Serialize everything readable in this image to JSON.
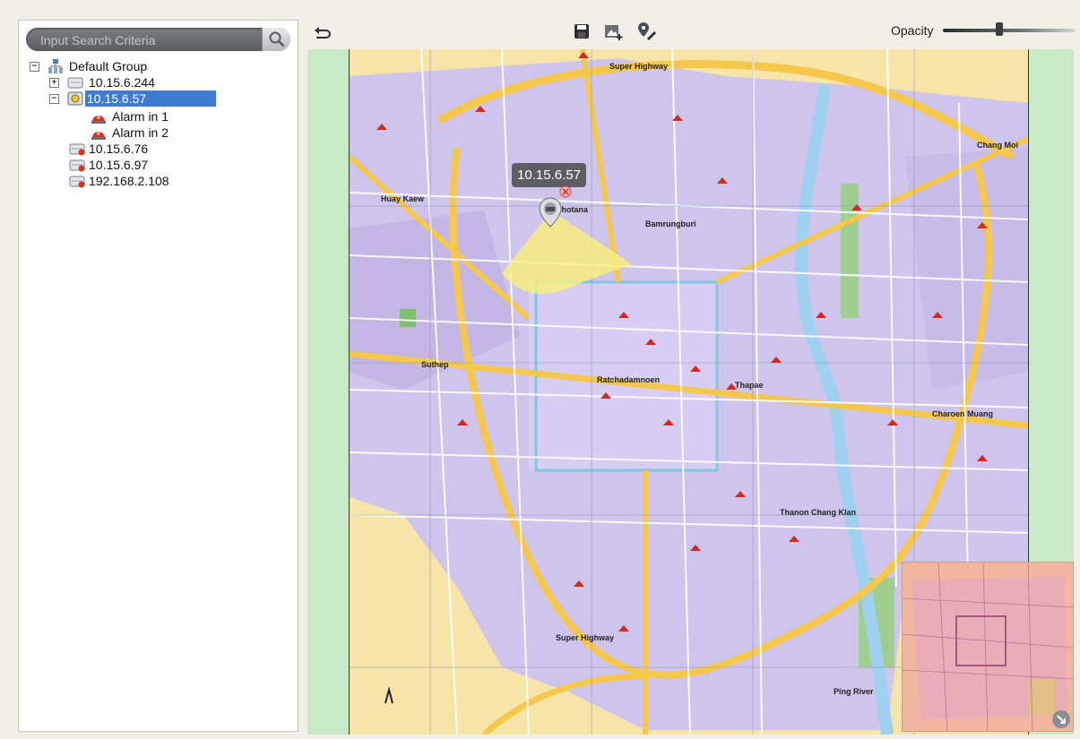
{
  "search": {
    "placeholder": "Input Search Criteria"
  },
  "tree": {
    "root": "Default Group",
    "devices": [
      {
        "label": "10.15.6.244",
        "expanded": false
      },
      {
        "label": "10.15.6.57",
        "expanded": true,
        "selected": true
      },
      {
        "label": "10.15.6.76"
      },
      {
        "label": "10.15.6.97"
      },
      {
        "label": "192.168.2.108"
      }
    ],
    "alarms": [
      "Alarm in 1",
      "Alarm in 2"
    ]
  },
  "toolbar": {
    "back_icon": "back-arrow-icon",
    "save_icon": "save-icon",
    "add_map_icon": "add-map-icon",
    "edit_location_icon": "edit-location-icon",
    "opacity_label": "Opacity",
    "opacity_value": 0.45
  },
  "map": {
    "tooltip": "10.15.6.57",
    "labels": [
      "Super Highway",
      "Super Highway",
      "Chotana",
      "Bamrungburi",
      "Thapae",
      "Charoen Muang",
      "Ratchadamnoen",
      "Suthep",
      "Chang Moi",
      "Ping River",
      "Huay Kaew",
      "Thanon Chang Klan"
    ]
  },
  "colors": {
    "selection": "#3f7bd2",
    "map_bg": "#f7e4a8",
    "accent_green": "#c9eac6"
  }
}
